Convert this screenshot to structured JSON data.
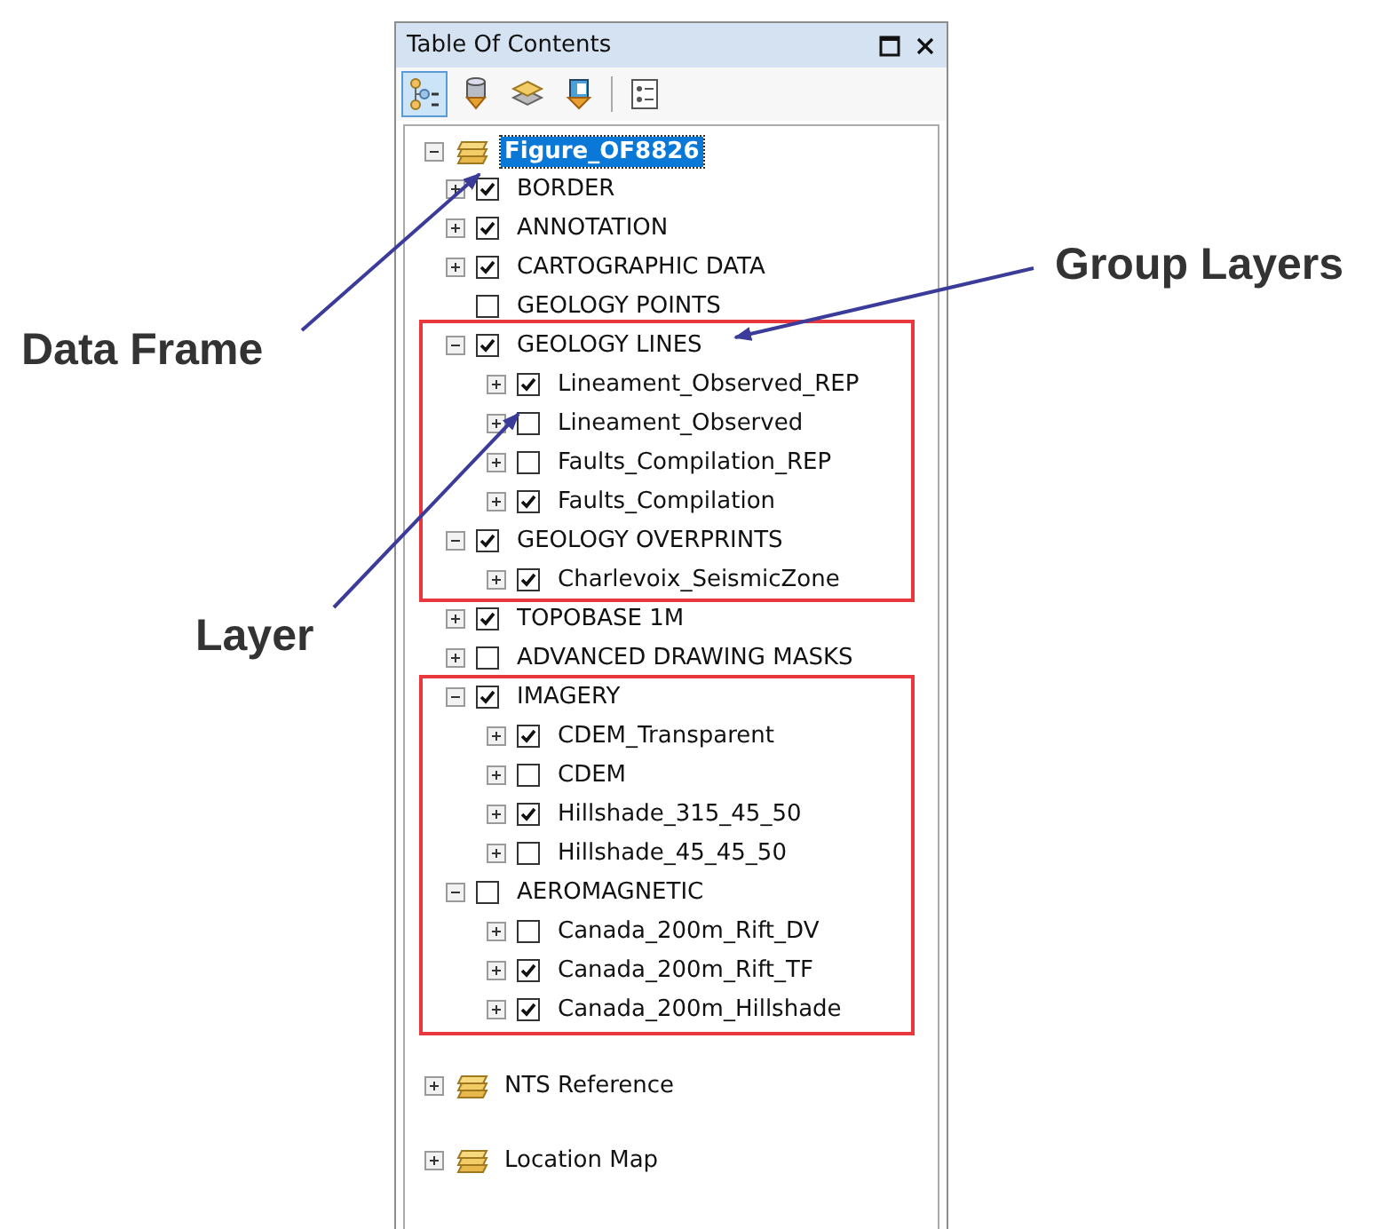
{
  "panel": {
    "title": "Table Of Contents"
  },
  "toolbar": [
    {
      "kind": "drawing-order",
      "selected": true
    },
    {
      "kind": "source",
      "selected": false
    },
    {
      "kind": "visibility",
      "selected": false
    },
    {
      "kind": "selection",
      "selected": false
    },
    {
      "kind": "options",
      "selected": false
    }
  ],
  "data_frames": [
    {
      "name": "Figure_OF8826",
      "selected": true,
      "expanded": true,
      "layers": [
        {
          "name": "BORDER",
          "kind": "expandable",
          "checked": true
        },
        {
          "name": "ANNOTATION",
          "kind": "expandable",
          "checked": true
        },
        {
          "name": "CARTOGRAPHIC DATA",
          "kind": "expandable",
          "checked": true
        },
        {
          "name": "GEOLOGY POINTS",
          "kind": "plain",
          "checked": false
        },
        {
          "name": "GEOLOGY LINES",
          "kind": "expandable",
          "expanded": true,
          "checked": true,
          "children": [
            {
              "name": "Lineament_Observed_REP",
              "kind": "expandable",
              "checked": true
            },
            {
              "name": "Lineament_Observed",
              "kind": "expandable",
              "checked": false
            },
            {
              "name": "Faults_Compilation_REP",
              "kind": "expandable",
              "checked": false
            },
            {
              "name": "Faults_Compilation",
              "kind": "expandable",
              "checked": true
            }
          ]
        },
        {
          "name": "GEOLOGY OVERPRINTS",
          "kind": "expandable",
          "expanded": true,
          "checked": true,
          "children": [
            {
              "name": "Charlevoix_SeismicZone",
              "kind": "expandable",
              "checked": true
            }
          ]
        },
        {
          "name": "TOPOBASE 1M",
          "kind": "expandable",
          "checked": true
        },
        {
          "name": "ADVANCED DRAWING MASKS",
          "kind": "expandable",
          "checked": false
        },
        {
          "name": "IMAGERY",
          "kind": "expandable",
          "expanded": true,
          "checked": true,
          "children": [
            {
              "name": "CDEM_Transparent",
              "kind": "expandable",
              "checked": true
            },
            {
              "name": "CDEM",
              "kind": "expandable",
              "checked": false
            },
            {
              "name": "Hillshade_315_45_50",
              "kind": "expandable",
              "checked": true
            },
            {
              "name": "Hillshade_45_45_50",
              "kind": "expandable",
              "checked": false
            }
          ]
        },
        {
          "name": "AEROMAGNETIC",
          "kind": "expandable",
          "expanded": true,
          "checked": false,
          "children": [
            {
              "name": "Canada_200m_Rift_DV",
              "kind": "expandable",
              "checked": false
            },
            {
              "name": "Canada_200m_Rift_TF",
              "kind": "expandable",
              "checked": true
            },
            {
              "name": "Canada_200m_Hillshade",
              "kind": "expandable",
              "checked": true
            }
          ]
        }
      ]
    },
    {
      "name": "NTS Reference",
      "selected": false,
      "expanded": false
    },
    {
      "name": "Location Map",
      "selected": false,
      "expanded": false
    }
  ],
  "annotations": [
    "Data Frame",
    "Group Layers",
    "Layer"
  ]
}
